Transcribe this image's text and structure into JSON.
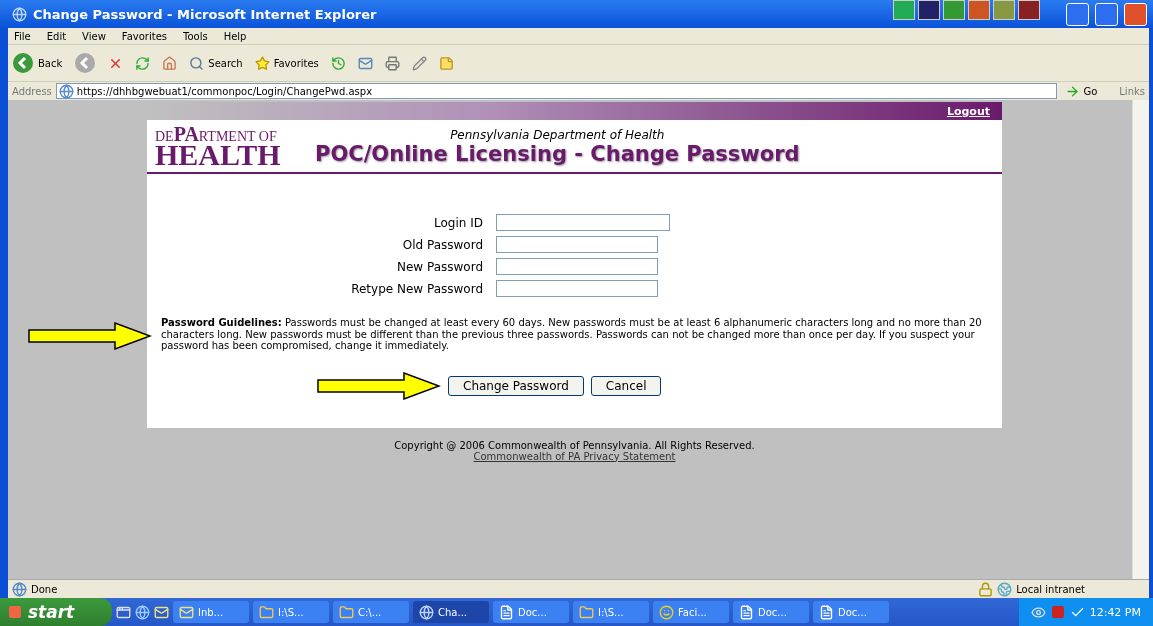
{
  "window": {
    "title": "Change Password - Microsoft Internet Explorer"
  },
  "menu": [
    "File",
    "Edit",
    "View",
    "Favorites",
    "Tools",
    "Help"
  ],
  "toolbar": {
    "back": "Back",
    "search": "Search",
    "favorites": "Favorites"
  },
  "address": {
    "label": "Address",
    "url": "https://dhhbgwebuat1/commonpoc/Login/ChangePwd.aspx",
    "go": "Go",
    "links": "Links"
  },
  "page": {
    "logout": "Logout",
    "logo_top": "DE**PA**RTMENT OF",
    "logo_bottom": "HEALTH",
    "agency": "Pennsylvania Department of Health",
    "heading": "POC/Online Licensing - Change Password",
    "fields": [
      {
        "label": "Login ID",
        "wide": true
      },
      {
        "label": "Old Password",
        "wide": false
      },
      {
        "label": "New Password",
        "wide": false
      },
      {
        "label": "Retype New Password",
        "wide": false
      }
    ],
    "guidelines": "**Password Guidelines:** Passwords must be changed at least every 60 days. New passwords must be at least 6 alphanumeric characters long and no more than 20 characters long. New passwords must be different than the previous three passwords. Passwords can not be changed more than once per day. If you suspect your password has been compromised, change it immediately.",
    "buttons": [
      "Change Password",
      "Cancel"
    ],
    "copyright": "Copyright @ 2006 Commonwealth of Pennsylvania. All Rights Reserved.",
    "privacy_link": "Commonwealth of PA Privacy Statement"
  },
  "status_bar": {
    "status": "Done",
    "zone": "Local intranet"
  },
  "taskbar": {
    "start": "start",
    "items": [
      {
        "label": "Inb...",
        "kind": "mail",
        "selected": false
      },
      {
        "label": "I:\\S...",
        "kind": "folder",
        "selected": false
      },
      {
        "label": "C:\\...",
        "kind": "folder",
        "selected": false
      },
      {
        "label": "Cha...",
        "kind": "ie",
        "selected": true
      },
      {
        "label": "Doc...",
        "kind": "word",
        "selected": false
      },
      {
        "label": "I:\\S...",
        "kind": "folder",
        "selected": false
      },
      {
        "label": "Faci...",
        "kind": "app",
        "selected": false
      },
      {
        "label": "Doc...",
        "kind": "word",
        "selected": false
      },
      {
        "label": "Doc...",
        "kind": "word",
        "selected": false
      }
    ],
    "clock": "12:42 PM"
  }
}
